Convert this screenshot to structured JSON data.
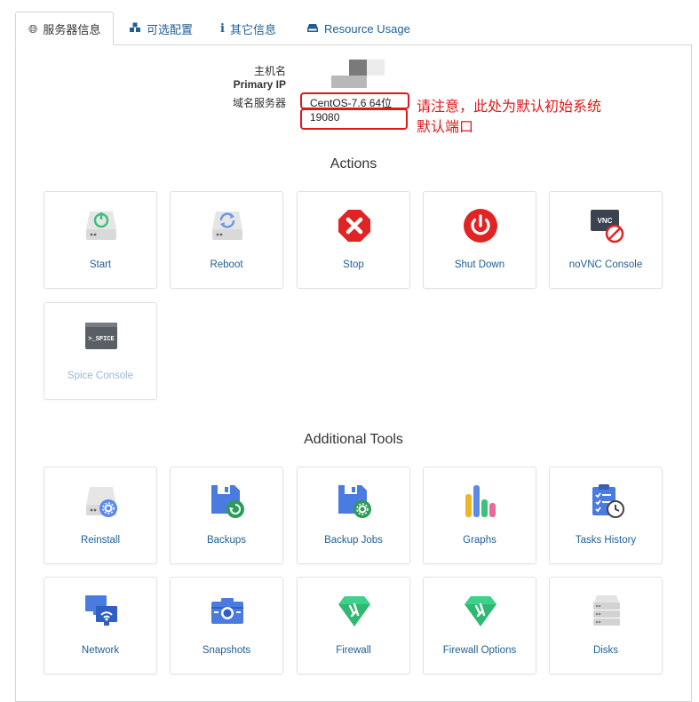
{
  "tabs": [
    {
      "label": "服务器信息",
      "icon": "globe-icon",
      "active": true
    },
    {
      "label": "可选配置",
      "icon": "cubes-icon",
      "active": false
    },
    {
      "label": "其它信息",
      "icon": "info-icon",
      "active": false
    },
    {
      "label": "Resource Usage",
      "icon": "hdd-icon",
      "active": false
    }
  ],
  "server_info": {
    "hostname_label": "主机名",
    "primary_ip_label": "Primary IP",
    "nameserver_label": "域名服务器",
    "os_value": "CentOS-7.6 64位",
    "port_value": "19080"
  },
  "annotations": {
    "os_note": "请注意，此处为默认初始系统",
    "port_note": "默认端口",
    "color": "#e01818"
  },
  "sections": {
    "actions_title": "Actions",
    "tools_title": "Additional Tools"
  },
  "actions": [
    {
      "label": "Start",
      "icon": "server-power-icon"
    },
    {
      "label": "Reboot",
      "icon": "server-reboot-icon"
    },
    {
      "label": "Stop",
      "icon": "stop-icon"
    },
    {
      "label": "Shut Down",
      "icon": "power-icon"
    },
    {
      "label": "noVNC Console",
      "icon": "vnc-icon"
    },
    {
      "label": "Spice Console",
      "icon": "spice-icon",
      "disabled": true
    }
  ],
  "tools": [
    {
      "label": "Reinstall",
      "icon": "reinstall-icon"
    },
    {
      "label": "Backups",
      "icon": "backups-icon"
    },
    {
      "label": "Backup Jobs",
      "icon": "backup-jobs-icon"
    },
    {
      "label": "Graphs",
      "icon": "graphs-icon"
    },
    {
      "label": "Tasks History",
      "icon": "tasks-history-icon"
    },
    {
      "label": "Network",
      "icon": "network-icon"
    },
    {
      "label": "Snapshots",
      "icon": "snapshots-icon"
    },
    {
      "label": "Firewall",
      "icon": "firewall-icon"
    },
    {
      "label": "Firewall Options",
      "icon": "firewall-options-icon"
    },
    {
      "label": "Disks",
      "icon": "disks-icon"
    }
  ],
  "colors": {
    "link": "#1f5f95",
    "green": "#3ec07a",
    "red": "#e02424",
    "blue": "#4a7be0"
  }
}
